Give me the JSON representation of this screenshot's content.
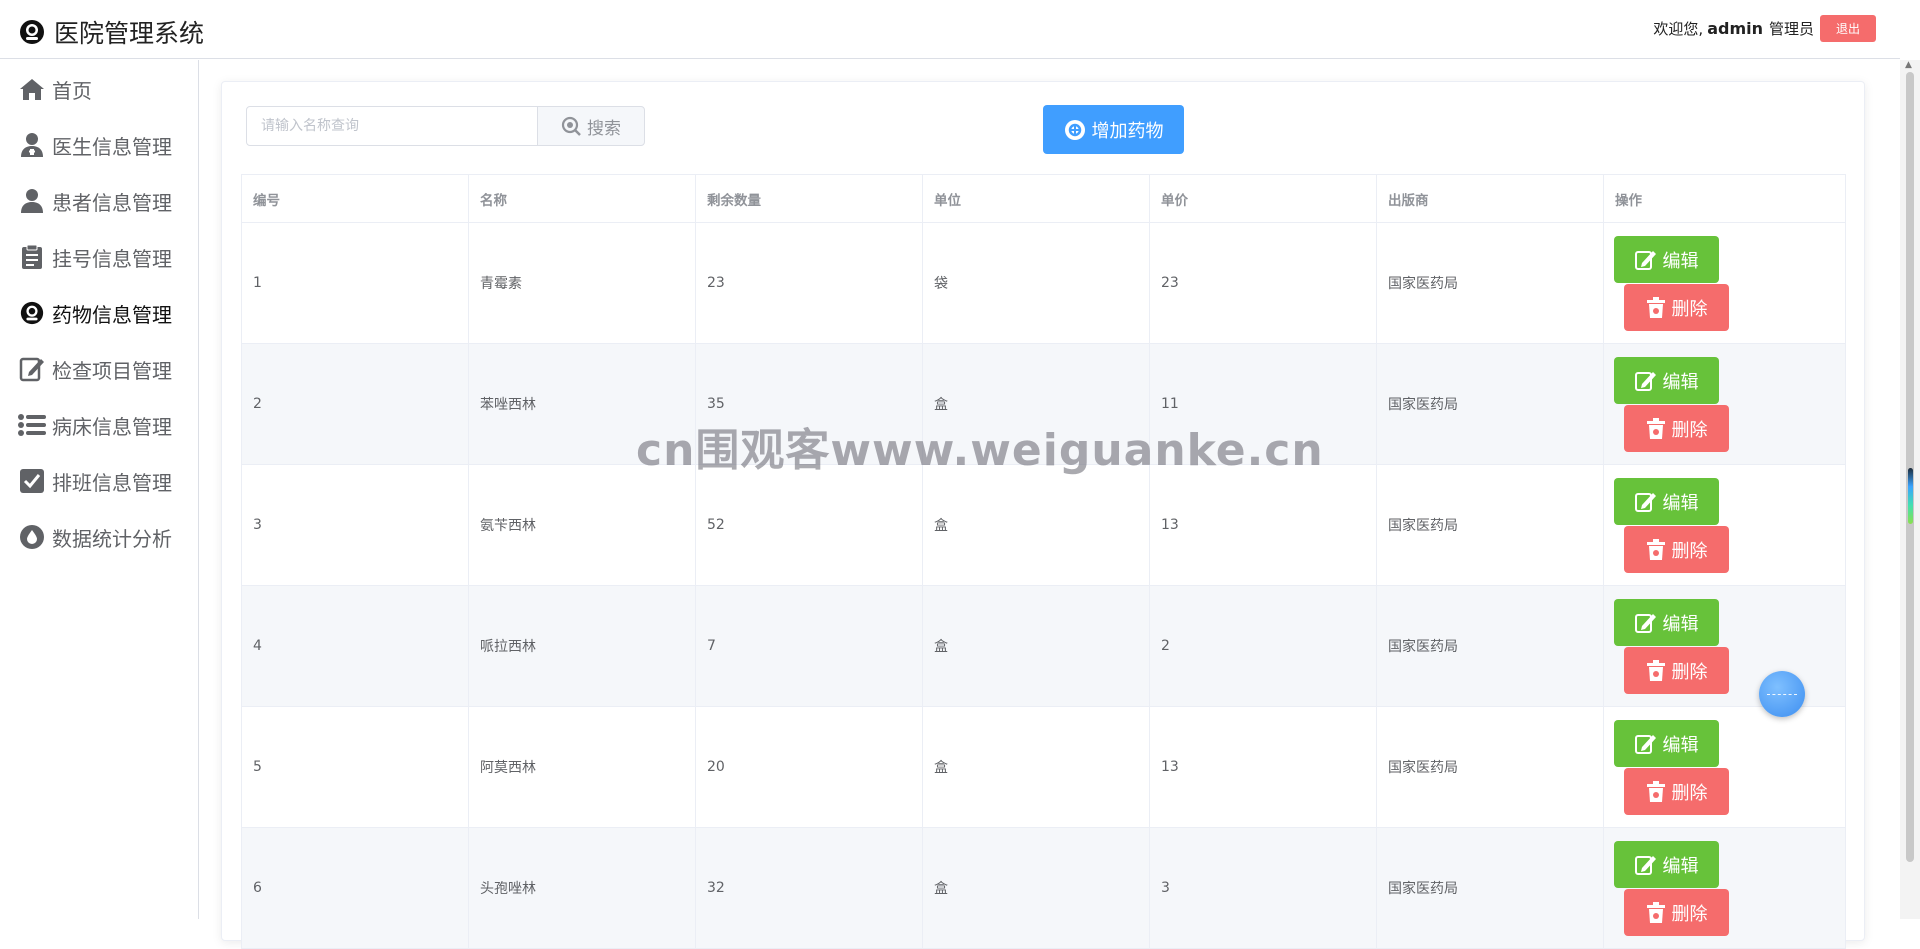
{
  "app": {
    "title": "医院管理系统"
  },
  "header": {
    "welcome": "欢迎您,",
    "username": "admin",
    "role": "管理员",
    "logout_label": "退出"
  },
  "sidebar": {
    "items": [
      {
        "label": "首页",
        "icon": "home-icon"
      },
      {
        "label": "医生信息管理",
        "icon": "doctor-icon"
      },
      {
        "label": "患者信息管理",
        "icon": "patient-icon"
      },
      {
        "label": "挂号信息管理",
        "icon": "clipboard-icon"
      },
      {
        "label": "药物信息管理",
        "icon": "pill-icon",
        "active": true
      },
      {
        "label": "检查项目管理",
        "icon": "edit-icon"
      },
      {
        "label": "病床信息管理",
        "icon": "list-icon"
      },
      {
        "label": "排班信息管理",
        "icon": "checkbox-icon"
      },
      {
        "label": "数据统计分析",
        "icon": "drop-icon"
      }
    ]
  },
  "toolbar": {
    "search_placeholder": "请输入名称查询",
    "search_label": "搜索",
    "add_label": "增加药物"
  },
  "table": {
    "columns": [
      "编号",
      "名称",
      "剩余数量",
      "单位",
      "单价",
      "出版商",
      "操作"
    ],
    "rows": [
      {
        "id": "1",
        "name": "青霉素",
        "qty": "23",
        "unit": "袋",
        "price": "23",
        "publisher": "国家医药局"
      },
      {
        "id": "2",
        "name": "苯唑西林",
        "qty": "35",
        "unit": "盒",
        "price": "11",
        "publisher": "国家医药局"
      },
      {
        "id": "3",
        "name": "氨苄西林",
        "qty": "52",
        "unit": "盒",
        "price": "13",
        "publisher": "国家医药局"
      },
      {
        "id": "4",
        "name": "哌拉西林",
        "qty": "7",
        "unit": "盒",
        "price": "2",
        "publisher": "国家医药局"
      },
      {
        "id": "5",
        "name": "阿莫西林",
        "qty": "20",
        "unit": "盒",
        "price": "13",
        "publisher": "国家医药局"
      },
      {
        "id": "6",
        "name": "头孢唑林",
        "qty": "32",
        "unit": "盒",
        "price": "3",
        "publisher": "国家医药局"
      }
    ],
    "edit_label": "编辑",
    "delete_label": "删除"
  },
  "watermark": "cn围观客www.weiguanke.cn",
  "colors": {
    "primary": "#409eff",
    "success": "#67c23a",
    "danger": "#f56c6c"
  }
}
